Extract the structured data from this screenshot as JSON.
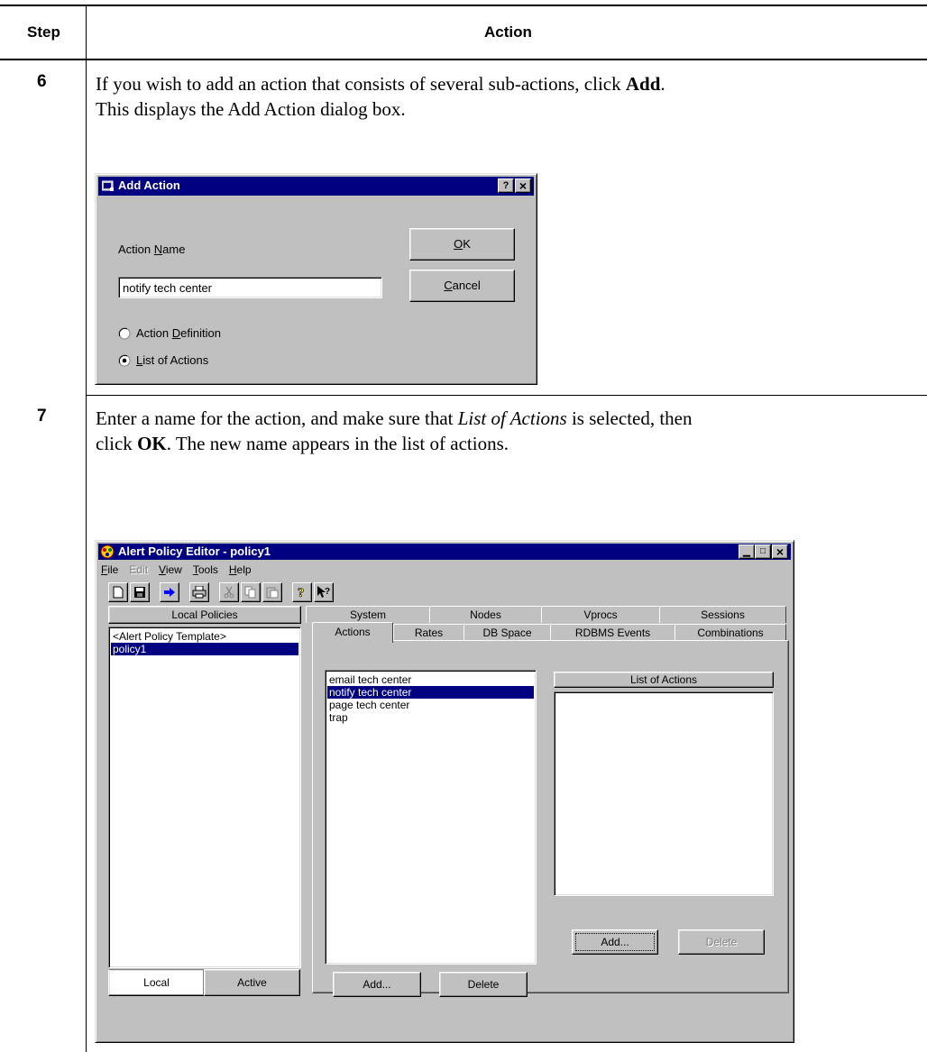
{
  "table": {
    "header_step": "Step",
    "header_action": "Action"
  },
  "step6": {
    "num": "6",
    "text_part1": "If you wish to add an action that consists of several sub-actions, click ",
    "text_bold": "Add",
    "text_part2": ".",
    "text_line2": "This displays the Add Action dialog box."
  },
  "step7": {
    "num": "7",
    "text_part1": "Enter a name for the action, and make sure that ",
    "text_italic": "List of Actions",
    "text_part2": " is selected, then",
    "text_line2_pre": "click ",
    "text_bold": "OK",
    "text_line2_post": ". The new name appears in the list of actions."
  },
  "add_action_dialog": {
    "title": "Add Action",
    "help_btn": "?",
    "close_btn": "×",
    "action_name_label_pre": "Action ",
    "action_name_label_key": "N",
    "action_name_label_post": "ame",
    "action_name_value": "notify tech center",
    "ok_key": "O",
    "ok_rest": "K",
    "cancel_key": "C",
    "cancel_rest": "ancel",
    "radio1_pre": "Action ",
    "radio1_key": "D",
    "radio1_post": "efinition",
    "radio2_key": "L",
    "radio2_post": "ist of Actions",
    "selected": "List of Actions"
  },
  "editor_window": {
    "title": "Alert Policy Editor - policy1",
    "menu": [
      {
        "key": "F",
        "rest": "ile",
        "enabled": true
      },
      {
        "key": "",
        "rest": "Edit",
        "enabled": false
      },
      {
        "key": "V",
        "rest": "iew",
        "enabled": true
      },
      {
        "key": "T",
        "rest": "ools",
        "enabled": true
      },
      {
        "key": "H",
        "rest": "elp",
        "enabled": true
      }
    ],
    "local_policies_header": "Local Policies",
    "policies": [
      "<Alert Policy Template>",
      "policy1"
    ],
    "selected_policy": "policy1",
    "bottom_tabs": {
      "local": "Local",
      "active": "Active"
    },
    "tabs_row1": [
      "System",
      "Nodes",
      "Vprocs",
      "Sessions"
    ],
    "tabs_row2": [
      "Actions",
      "Rates",
      "DB Space",
      "RDBMS Events",
      "Combinations"
    ],
    "active_tab": "Actions",
    "actions": [
      "email tech center",
      "notify tech center",
      "page tech center",
      "trap"
    ],
    "selected_action": "notify tech center",
    "list_of_actions_header": "List of Actions",
    "add_btn_left": "Add...",
    "delete_btn_left": "Delete",
    "add_btn_right": "Add...",
    "delete_btn_right": "Delete"
  }
}
